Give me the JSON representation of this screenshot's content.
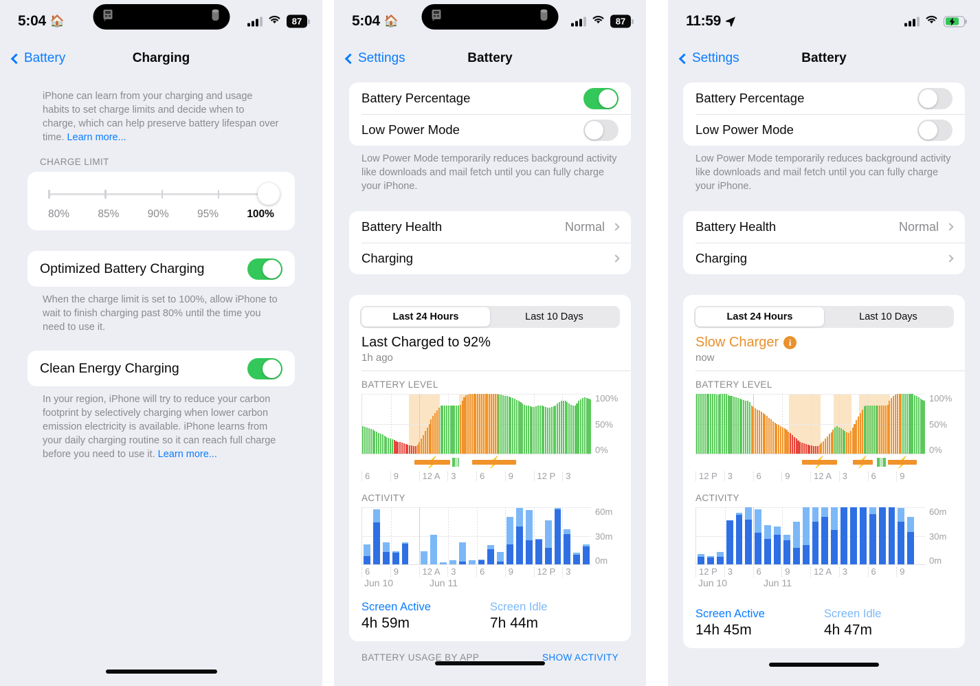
{
  "screen1": {
    "status": {
      "time": "5:04",
      "home_icon": "house-icon",
      "battery_level": "87",
      "wifi_icon": "wifi-icon",
      "cellular_icon": "cellular-icon"
    },
    "nav": {
      "back_label": "Battery",
      "title": "Charging"
    },
    "intro": "iPhone can learn from your charging and usage habits to set charge limits and decide when to charge, which can help preserve battery lifespan over time. ",
    "intro_link": "Learn more...",
    "charge_limit_header": "CHARGE LIMIT",
    "charge_limit": {
      "options": [
        "80%",
        "85%",
        "90%",
        "95%",
        "100%"
      ],
      "selected": "100%"
    },
    "optimized": {
      "label": "Optimized Battery Charging",
      "value": "on"
    },
    "optimized_note": "When the charge limit is set to 100%, allow iPhone to wait to finish charging past 80% until the time you need to use it.",
    "clean_energy": {
      "label": "Clean Energy Charging",
      "value": "on"
    },
    "clean_energy_note": "In your region, iPhone will try to reduce your carbon footprint by selectively charging when lower carbon emission electricity is available. iPhone learns from your daily charging routine so it can reach full charge before you need to use it. ",
    "clean_energy_link": "Learn more..."
  },
  "screen2": {
    "status": {
      "time": "5:04",
      "home_icon": "house-icon",
      "battery_level": "87"
    },
    "nav": {
      "back_label": "Settings",
      "title": "Battery"
    },
    "battery_percentage": {
      "label": "Battery Percentage",
      "value": "on"
    },
    "low_power_mode": {
      "label": "Low Power Mode",
      "value": "off"
    },
    "low_power_note": "Low Power Mode temporarily reduces background activity like downloads and mail fetch until you can fully charge your iPhone.",
    "battery_health": {
      "label": "Battery Health",
      "value": "Normal"
    },
    "charging": {
      "label": "Charging",
      "value": ""
    },
    "segments": [
      "Last 24 Hours",
      "Last 10 Days"
    ],
    "segment_selected": "Last 24 Hours",
    "last_charged_title": "Last Charged to 92%",
    "last_charged_sub": "1h ago",
    "totals": {
      "active_label": "Screen Active",
      "active_value": "4h 59m",
      "idle_label": "Screen Idle",
      "idle_value": "7h 44m"
    },
    "usage_header": "BATTERY USAGE BY APP",
    "usage_action": "SHOW ACTIVITY"
  },
  "screen3": {
    "status": {
      "time": "11:59",
      "location_icon": "location-arrow-icon",
      "battery_state": "charging"
    },
    "nav": {
      "back_label": "Settings",
      "title": "Battery"
    },
    "battery_percentage": {
      "label": "Battery Percentage",
      "value": "off"
    },
    "low_power_mode": {
      "label": "Low Power Mode",
      "value": "off"
    },
    "low_power_note": "Low Power Mode temporarily reduces background activity like downloads and mail fetch until you can fully charge your iPhone.",
    "battery_health": {
      "label": "Battery Health",
      "value": "Normal"
    },
    "charging": {
      "label": "Charging",
      "value": ""
    },
    "segments": [
      "Last 24 Hours",
      "Last 10 Days"
    ],
    "segment_selected": "Last 24 Hours",
    "slow_charger_title": "Slow Charger",
    "slow_charger_info": "i",
    "slow_charger_sub": "now",
    "totals": {
      "active_label": "Screen Active",
      "active_value": "14h 45m",
      "idle_label": "Screen Idle",
      "idle_value": "4h 47m"
    }
  },
  "common": {
    "battery_level_title": "BATTERY LEVEL",
    "activity_title": "ACTIVITY",
    "ylabels_battery": [
      "100%",
      "50%",
      "0%"
    ],
    "ylabels_activity": [
      "60m",
      "30m",
      "0m"
    ]
  },
  "colors": {
    "accent_blue": "#0a7cff",
    "green": "#34c759",
    "chart_green": "#5cc95c",
    "chart_orange": "#f0932b",
    "chart_red": "#e8453c",
    "chart_shade": "#fbe4c4",
    "bar_dark_blue": "#2f6fe4",
    "bar_light_blue": "#7cb8f7",
    "warn_orange": "#e8912d",
    "page_bg": "#eceef3",
    "card_bg": "#ffffff"
  },
  "chart_data": [
    {
      "id": "screen2-battery-level",
      "type": "bar",
      "title": "BATTERY LEVEL",
      "ylabel": "",
      "xlabel": "",
      "ylim": [
        0,
        100
      ],
      "ytick_labels": [
        "100%",
        "50%",
        "0%"
      ],
      "xtick_labels": [
        "6",
        "9",
        "12 A",
        "3",
        "6",
        "9",
        "12 P",
        "3"
      ],
      "grid": true,
      "legend": "none",
      "values": [
        46,
        45,
        44,
        42,
        41,
        40,
        38,
        37,
        35,
        33,
        32,
        30,
        28,
        27,
        25,
        24,
        23,
        21,
        20,
        19,
        18,
        17,
        16,
        15,
        14,
        14,
        13,
        13,
        15,
        19,
        25,
        31,
        38,
        44,
        50,
        57,
        63,
        68,
        73,
        77,
        80,
        80,
        80,
        80,
        80,
        80,
        80,
        80,
        80,
        80,
        82,
        88,
        94,
        98,
        99,
        100,
        100,
        100,
        100,
        100,
        100,
        100,
        100,
        100,
        100,
        100,
        100,
        100,
        100,
        100,
        99,
        99,
        98,
        97,
        96,
        95,
        94,
        93,
        92,
        90,
        88,
        86,
        84,
        82,
        81,
        80,
        79,
        78,
        78,
        79,
        80,
        81,
        80,
        79,
        78,
        77,
        77,
        78,
        79,
        81,
        84,
        86,
        88,
        89,
        88,
        86,
        84,
        82,
        80,
        81,
        84,
        88,
        91,
        93,
        94,
        93,
        92,
        91
      ],
      "bar_colors": [
        "green",
        "green",
        "green",
        "green",
        "green",
        "green",
        "green",
        "green",
        "green",
        "green",
        "green",
        "green",
        "green",
        "green",
        "green",
        "green",
        "red",
        "red",
        "red",
        "red",
        "red",
        "red",
        "red",
        "red",
        "red",
        "red",
        "red",
        "red",
        "orange",
        "orange",
        "orange",
        "orange",
        "orange",
        "orange",
        "orange",
        "orange",
        "orange",
        "orange",
        "orange",
        "orange",
        "green",
        "green",
        "green",
        "green",
        "green",
        "green",
        "green",
        "green",
        "green",
        "green",
        "orange",
        "orange",
        "orange",
        "orange",
        "orange",
        "orange",
        "orange",
        "orange",
        "orange",
        "orange",
        "orange",
        "orange",
        "orange",
        "orange",
        "orange",
        "orange",
        "orange",
        "orange",
        "orange",
        "orange",
        "green",
        "green",
        "green",
        "green",
        "green",
        "green",
        "green",
        "green",
        "green",
        "green",
        "green",
        "green",
        "green",
        "green",
        "green",
        "green",
        "green",
        "green",
        "green",
        "green",
        "green",
        "green",
        "green",
        "green",
        "green",
        "green",
        "green",
        "green",
        "green",
        "green",
        "green",
        "green",
        "green",
        "green",
        "green",
        "green",
        "green",
        "green",
        "green",
        "green",
        "green",
        "green",
        "green",
        "green",
        "green",
        "green",
        "green",
        "green"
      ],
      "charge_shading": [
        [
          24,
          40
        ],
        [
          50,
          70
        ]
      ],
      "charge_strip": [
        {
          "start": 24,
          "end": 40,
          "kind": "charging"
        },
        {
          "start": 41,
          "end": 44,
          "kind": "paused"
        },
        {
          "start": 50,
          "end": 70,
          "kind": "charging"
        }
      ]
    },
    {
      "id": "screen2-activity",
      "type": "bar",
      "title": "ACTIVITY",
      "ylim": [
        0,
        60
      ],
      "ytick_labels": [
        "60m",
        "30m",
        "0m"
      ],
      "xtick_labels": [
        "6",
        "9",
        "12 A",
        "3",
        "6",
        "9",
        "12 P",
        "3"
      ],
      "date_labels": [
        "Jun 10",
        "Jun 11"
      ],
      "stacked": true,
      "series": [
        {
          "name": "Screen Active",
          "color": "#2f6fe4",
          "values": [
            9,
            44,
            13,
            12,
            22,
            0,
            0,
            0,
            0,
            0,
            3,
            0,
            4,
            16,
            3,
            21,
            40,
            25,
            26,
            17,
            58,
            32,
            10,
            19
          ]
        },
        {
          "name": "Screen Idle",
          "color": "#7cb8f7",
          "values": [
            12,
            14,
            10,
            2,
            1,
            0,
            14,
            31,
            2,
            4,
            20,
            4,
            1,
            4,
            10,
            29,
            19,
            32,
            1,
            29,
            1,
            5,
            2,
            2
          ]
        }
      ]
    },
    {
      "id": "screen3-battery-level",
      "type": "bar",
      "title": "BATTERY LEVEL",
      "ylim": [
        0,
        100
      ],
      "ytick_labels": [
        "100%",
        "50%",
        "0%"
      ],
      "xtick_labels": [
        "12 P",
        "3",
        "6",
        "9",
        "12 A",
        "3",
        "6",
        "9"
      ],
      "values": [
        100,
        100,
        100,
        100,
        100,
        100,
        100,
        100,
        100,
        100,
        99,
        99,
        100,
        100,
        100,
        100,
        98,
        97,
        96,
        95,
        94,
        93,
        92,
        91,
        90,
        89,
        88,
        86,
        80,
        78,
        76,
        74,
        72,
        70,
        68,
        66,
        63,
        60,
        57,
        54,
        52,
        50,
        48,
        46,
        44,
        42,
        40,
        37,
        34,
        31,
        28,
        25,
        22,
        20,
        18,
        17,
        16,
        15,
        14,
        14,
        13,
        13,
        13,
        15,
        18,
        21,
        25,
        29,
        33,
        36,
        40,
        44,
        46,
        44,
        42,
        40,
        38,
        36,
        35,
        38,
        44,
        50,
        56,
        62,
        68,
        74,
        79,
        80,
        80,
        80,
        80,
        80,
        80,
        80,
        80,
        80,
        80,
        80,
        82,
        88,
        93,
        97,
        99,
        100,
        100,
        100,
        100,
        100,
        100,
        100,
        100,
        100,
        98,
        96,
        94,
        92,
        90,
        88
      ],
      "bar_colors": [
        "green",
        "green",
        "green",
        "green",
        "green",
        "green",
        "green",
        "green",
        "green",
        "green",
        "green",
        "green",
        "green",
        "green",
        "green",
        "green",
        "green",
        "green",
        "green",
        "green",
        "green",
        "green",
        "green",
        "green",
        "green",
        "green",
        "green",
        "green",
        "orange",
        "orange",
        "orange",
        "orange",
        "orange",
        "orange",
        "orange",
        "orange",
        "orange",
        "orange",
        "orange",
        "orange",
        "orange",
        "orange",
        "orange",
        "orange",
        "orange",
        "orange",
        "orange",
        "orange",
        "red",
        "red",
        "red",
        "red",
        "red",
        "red",
        "red",
        "red",
        "red",
        "red",
        "red",
        "red",
        "red",
        "red",
        "red",
        "orange",
        "orange",
        "orange",
        "orange",
        "orange",
        "orange",
        "orange",
        "orange",
        "green",
        "green",
        "green",
        "green",
        "green",
        "green",
        "orange",
        "orange",
        "orange",
        "orange",
        "orange",
        "orange",
        "orange",
        "orange",
        "orange",
        "green",
        "green",
        "green",
        "green",
        "green",
        "green",
        "green",
        "orange",
        "orange",
        "orange",
        "orange",
        "orange",
        "orange",
        "orange",
        "orange",
        "orange",
        "orange",
        "orange",
        "orange",
        "orange",
        "green",
        "green",
        "green",
        "green",
        "green",
        "green",
        "green",
        "green",
        "green",
        "green"
      ],
      "charge_shading": [
        [
          48,
          64
        ],
        [
          71,
          80
        ],
        [
          84,
          100
        ]
      ],
      "charge_strip": [
        {
          "start": 48,
          "end": 64,
          "kind": "charging"
        },
        {
          "start": 71,
          "end": 80,
          "kind": "charging"
        },
        {
          "start": 82,
          "end": 86,
          "kind": "paused"
        },
        {
          "start": 87,
          "end": 100,
          "kind": "charging"
        }
      ]
    },
    {
      "id": "screen3-activity",
      "type": "bar",
      "title": "ACTIVITY",
      "ylim": [
        0,
        60
      ],
      "ytick_labels": [
        "60m",
        "30m",
        "0m"
      ],
      "xtick_labels": [
        "12 P",
        "3",
        "6",
        "9",
        "12 A",
        "3",
        "6",
        "9"
      ],
      "date_labels": [
        "Jun 10",
        "Jun 11"
      ],
      "stacked": true,
      "series": [
        {
          "name": "Screen Active",
          "color": "#2f6fe4",
          "values": [
            8,
            7,
            8,
            46,
            52,
            47,
            33,
            27,
            31,
            25,
            17,
            20,
            45,
            50,
            36,
            60,
            60,
            60,
            53,
            60,
            60,
            45,
            34,
            0
          ]
        },
        {
          "name": "Screen Idle",
          "color": "#7cb8f7",
          "values": [
            3,
            2,
            5,
            0,
            2,
            13,
            25,
            14,
            9,
            6,
            28,
            40,
            15,
            10,
            24,
            0,
            0,
            0,
            7,
            0,
            0,
            14,
            16,
            0
          ]
        }
      ]
    }
  ]
}
